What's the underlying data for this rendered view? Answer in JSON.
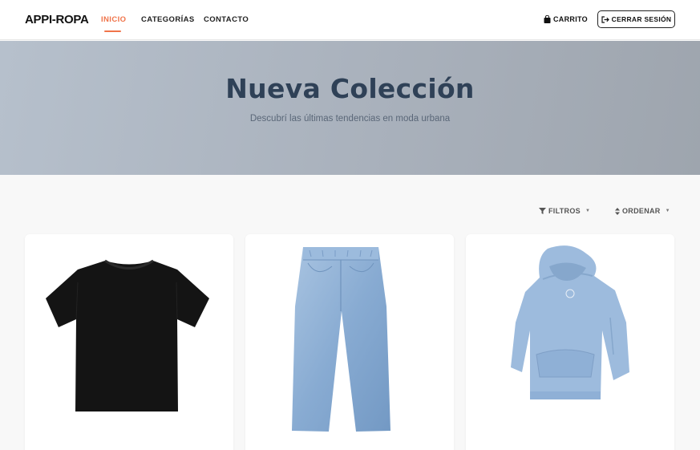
{
  "navbar": {
    "brand": "APPI-ROPA",
    "links": [
      {
        "label": "INICIO",
        "active": true
      },
      {
        "label": "CATEGORÍAS",
        "active": false
      },
      {
        "label": "CONTACTO",
        "active": false
      }
    ],
    "cart_label": "CARRITO",
    "cart_icon": "shopping-bag-icon",
    "logout_label": "CERRAR SESIÓN",
    "logout_icon": "sign-out-icon",
    "accent_color": "#f0744a"
  },
  "hero": {
    "title": "Nueva Colección",
    "subtitle": "Descubrí las últimas tendencias en moda urbana"
  },
  "toolbar": {
    "filters_label": "FILTROS",
    "filters_icon": "filter-icon",
    "sort_label": "ORDENAR",
    "sort_icon": "sort-icon"
  },
  "products": [
    {
      "image": "black-tshirt",
      "color": "#111111"
    },
    {
      "image": "light-blue-jeans",
      "color": "#8aaed3"
    },
    {
      "image": "light-blue-hoodie",
      "color": "#9dbbdd"
    }
  ]
}
